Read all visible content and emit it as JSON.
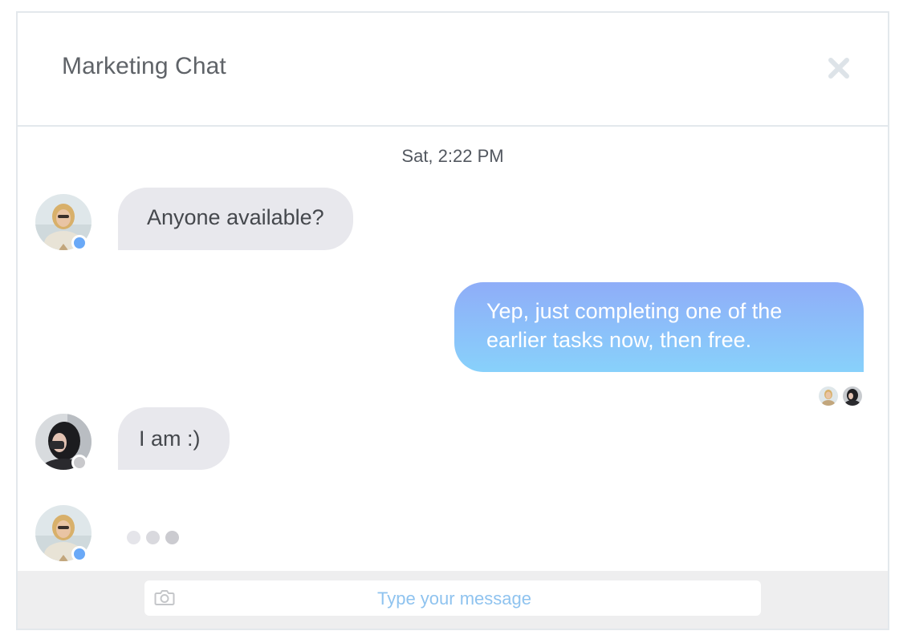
{
  "header": {
    "title": "Marketing Chat",
    "close_icon": "close-icon"
  },
  "timestamp": "Sat, 2:22 PM",
  "messages": [
    {
      "direction": "incoming",
      "text": "Anyone available?",
      "avatar": "avatar-blonde-woman",
      "presence": "online"
    },
    {
      "direction": "outgoing",
      "text": "Yep, just completing one of the earlier tasks now, then free.",
      "seen_by": [
        "avatar-blonde-woman",
        "avatar-dark-haired-woman"
      ]
    },
    {
      "direction": "incoming",
      "text": "I am :)",
      "avatar": "avatar-dark-haired-woman",
      "presence": "offline"
    }
  ],
  "typing_indicator": {
    "avatar": "avatar-blonde-woman",
    "presence": "online"
  },
  "composer": {
    "placeholder": "Type your message",
    "value": "",
    "camera_icon": "camera-icon"
  },
  "colors": {
    "incoming_bubble": "#e8e8ed",
    "outgoing_bubble_top": "#8fadf8",
    "outgoing_bubble_bottom": "#88d1fb",
    "online_status": "#6aa9f7",
    "offline_status": "#c9c9cc",
    "border": "#e3e8ec",
    "composer_bg": "#eeeeef",
    "placeholder": "#8fc3ef"
  }
}
